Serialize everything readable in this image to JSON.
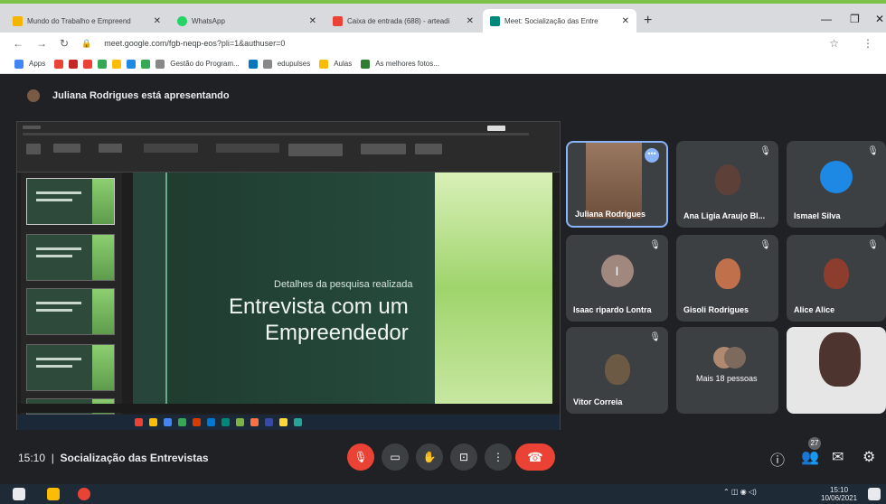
{
  "browser": {
    "tabs": [
      {
        "label": "Mundo do Trabalho e Empreend",
        "color": "#f4b400"
      },
      {
        "label": "WhatsApp",
        "color": "#25d366"
      },
      {
        "label": "Caixa de entrada (688) - arteadi",
        "color": "#ea4335"
      },
      {
        "label": "Meet: Socialização das Entre",
        "color": "#00897b"
      }
    ],
    "url": "meet.google.com/fgb-neqp-eos?pli=1&authuser=0",
    "bookmarks": [
      "Apps",
      "Gestão do Program...",
      "edupulses",
      "Aulas",
      "As melhores fotos..."
    ]
  },
  "meet": {
    "presenting": "Juliana Rodrigues está apresentando",
    "slide": {
      "subtitle": "Detalhes da pesquisa realizada",
      "title_line1": "Entrevista com um",
      "title_line2": "Empreendedor"
    },
    "participants": [
      {
        "name": "Juliana Rodrigues",
        "type": "photo"
      },
      {
        "name": "Ana Ligia Araujo Bl...",
        "type": "avatar",
        "color": "#5d4037"
      },
      {
        "name": "Ismael Silva",
        "type": "avatar",
        "color": "#1e88e5"
      },
      {
        "name": "Isaac ripardo Lontra",
        "type": "initial",
        "initial": "I",
        "color": "#a1887f"
      },
      {
        "name": "Gisoli Rodrigues",
        "type": "avatar",
        "color": "#c0704a"
      },
      {
        "name": "Alice Alice",
        "type": "avatar",
        "color": "#8d3d2e"
      },
      {
        "name": "Vitor Correia",
        "type": "avatar",
        "color": "#6d5a45"
      },
      {
        "name": "Mais 18 pessoas",
        "type": "group",
        "color": "#b08a70"
      }
    ],
    "time": "15:10",
    "meeting_title": "Socialização das Entrevistas",
    "people_count": "27"
  },
  "taskbar": {
    "time": "15:10",
    "date": "10/06/2021"
  }
}
